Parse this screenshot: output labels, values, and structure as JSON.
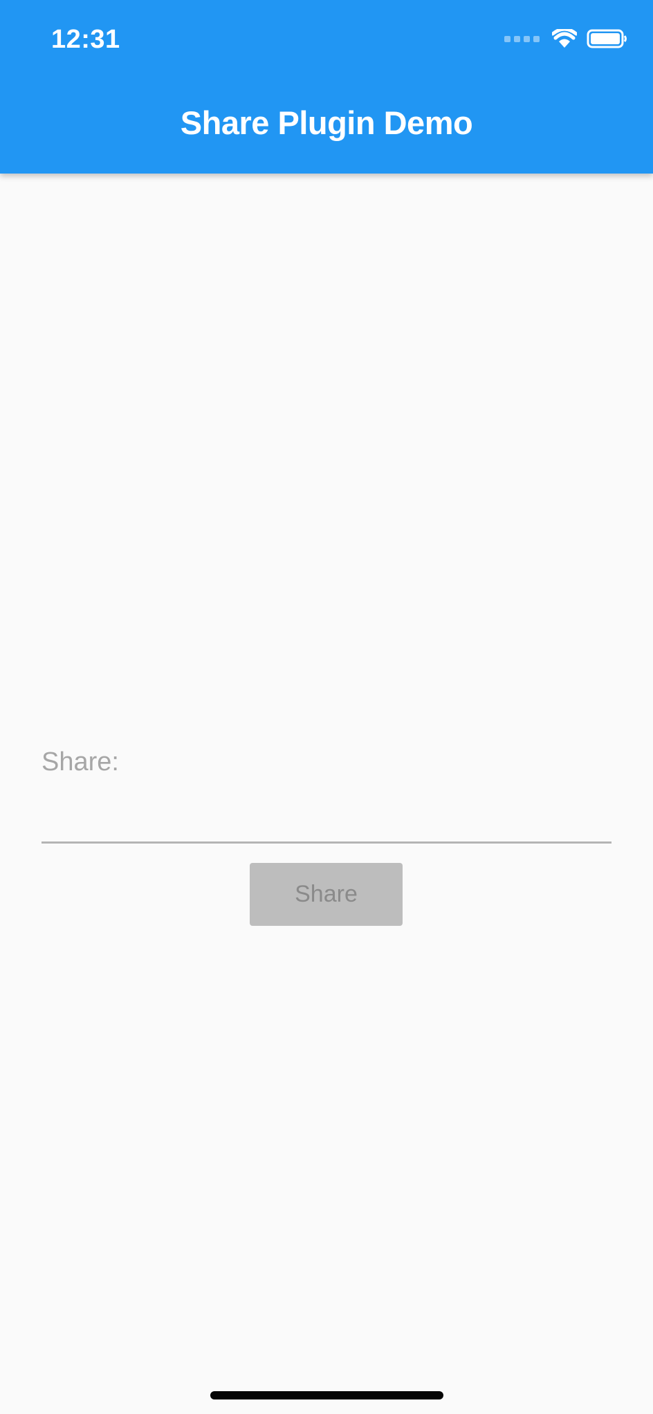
{
  "status_bar": {
    "time": "12:31",
    "icons": [
      "signal-dots-icon",
      "wifi-icon",
      "battery-icon"
    ]
  },
  "app_bar": {
    "title": "Share Plugin Demo",
    "color": "#2196f3"
  },
  "form": {
    "share_label": "Share:",
    "share_value": "",
    "share_button_label": "Share",
    "share_button_enabled": false
  }
}
